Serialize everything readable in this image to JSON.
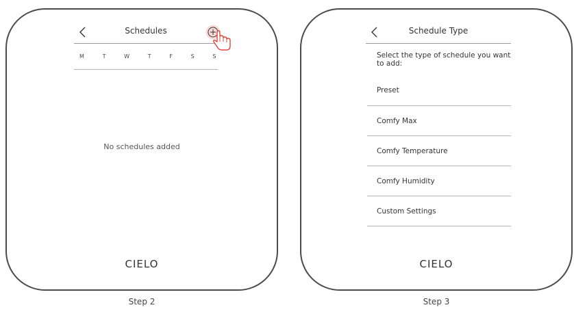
{
  "step2": {
    "header": {
      "title": "Schedules",
      "back_icon": "chevron-left-icon",
      "add_icon": "plus-circle-icon"
    },
    "days": [
      "M",
      "T",
      "W",
      "T",
      "F",
      "S",
      "S"
    ],
    "empty_message": "No schedules added",
    "logo": "CIELO",
    "caption": "Step 2"
  },
  "step3": {
    "header": {
      "title": "Schedule Type",
      "back_icon": "chevron-left-icon"
    },
    "prompt": "Select the type of schedule you want to add:",
    "options": [
      "Preset",
      "Comfy Max",
      "Comfy Temperature",
      "Comfy Humidity",
      "Custom Settings"
    ],
    "logo": "CIELO",
    "caption": "Step 3"
  },
  "colors": {
    "accent": "#e0453f",
    "accent_light": "#f8d9d7"
  }
}
